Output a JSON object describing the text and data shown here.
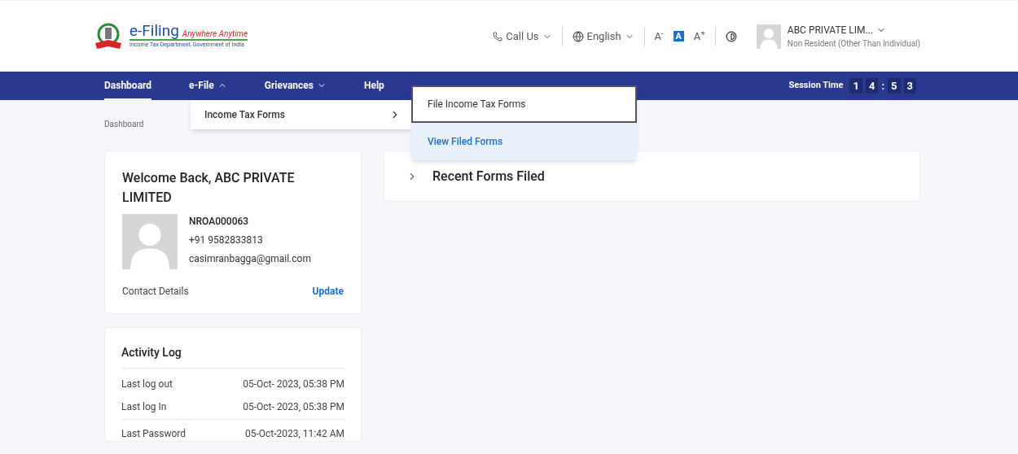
{
  "header": {
    "logo": {
      "title": "e-Filing",
      "tagline": "Anywhere Anytime",
      "subtitle": "Income Tax Department, Government of India"
    },
    "call_us": {
      "label": "Call Us"
    },
    "language": {
      "label": "English"
    },
    "font_sizes": [
      {
        "label": "A",
        "sign": "-",
        "selected": false
      },
      {
        "label": "A",
        "selected": true
      },
      {
        "label": "A",
        "sign": "+",
        "selected": false
      }
    ],
    "user": {
      "name": "ABC PRIVATE LIM...",
      "type": "Non Resident (Other Than Individual)"
    }
  },
  "nav": {
    "items": [
      {
        "label": "Dashboard",
        "selected": true
      },
      {
        "label": "e-File",
        "selected": false,
        "expanded": true
      },
      {
        "label": "Grievances",
        "selected": false,
        "expanded": false
      },
      {
        "label": "Help",
        "selected": false
      }
    ],
    "session": {
      "label": "Session Time",
      "digits": [
        "1",
        "4",
        "5",
        "3"
      ],
      "separator": ":"
    }
  },
  "menu": {
    "items": [
      {
        "label": "Income Tax Forms",
        "expanded": true
      }
    ],
    "submenu": [
      {
        "label": "File Income Tax Forms",
        "selected": false,
        "focused": true
      },
      {
        "label": "View Filed Forms",
        "selected": true,
        "focused": false
      }
    ]
  },
  "breadcrumb": "Dashboard",
  "profile": {
    "greeting": "Welcome Back, ABC PRIVATE LIMITED",
    "id": "NROA000063",
    "phone": "+91 9582833813",
    "email": "casimranbagga@gmail.com",
    "contact_label": "Contact Details",
    "update": "Update"
  },
  "activity": {
    "title": "Activity Log",
    "rows": [
      {
        "label": "Last log out",
        "value": "05-Oct- 2023, 05:38 PM"
      },
      {
        "label": "Last log In",
        "value": "05-Oct- 2023, 05:38 PM"
      },
      {
        "label": "Last Password",
        "value": "05-Oct-2023, 11:42 AM",
        "divider": true
      }
    ]
  },
  "recent": {
    "title": "Recent Forms Filed",
    "expanded": false
  }
}
